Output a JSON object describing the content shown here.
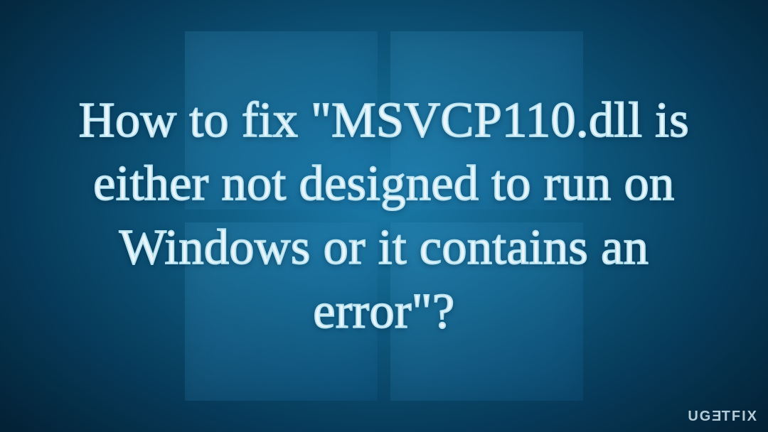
{
  "headline_text": "How to fix \"MSVCP110.dll is either not designed to run on Windows or it contains an error\"?",
  "watermark": {
    "prefix": "UG",
    "reversed_e": "E",
    "suffix": "TFIX"
  }
}
